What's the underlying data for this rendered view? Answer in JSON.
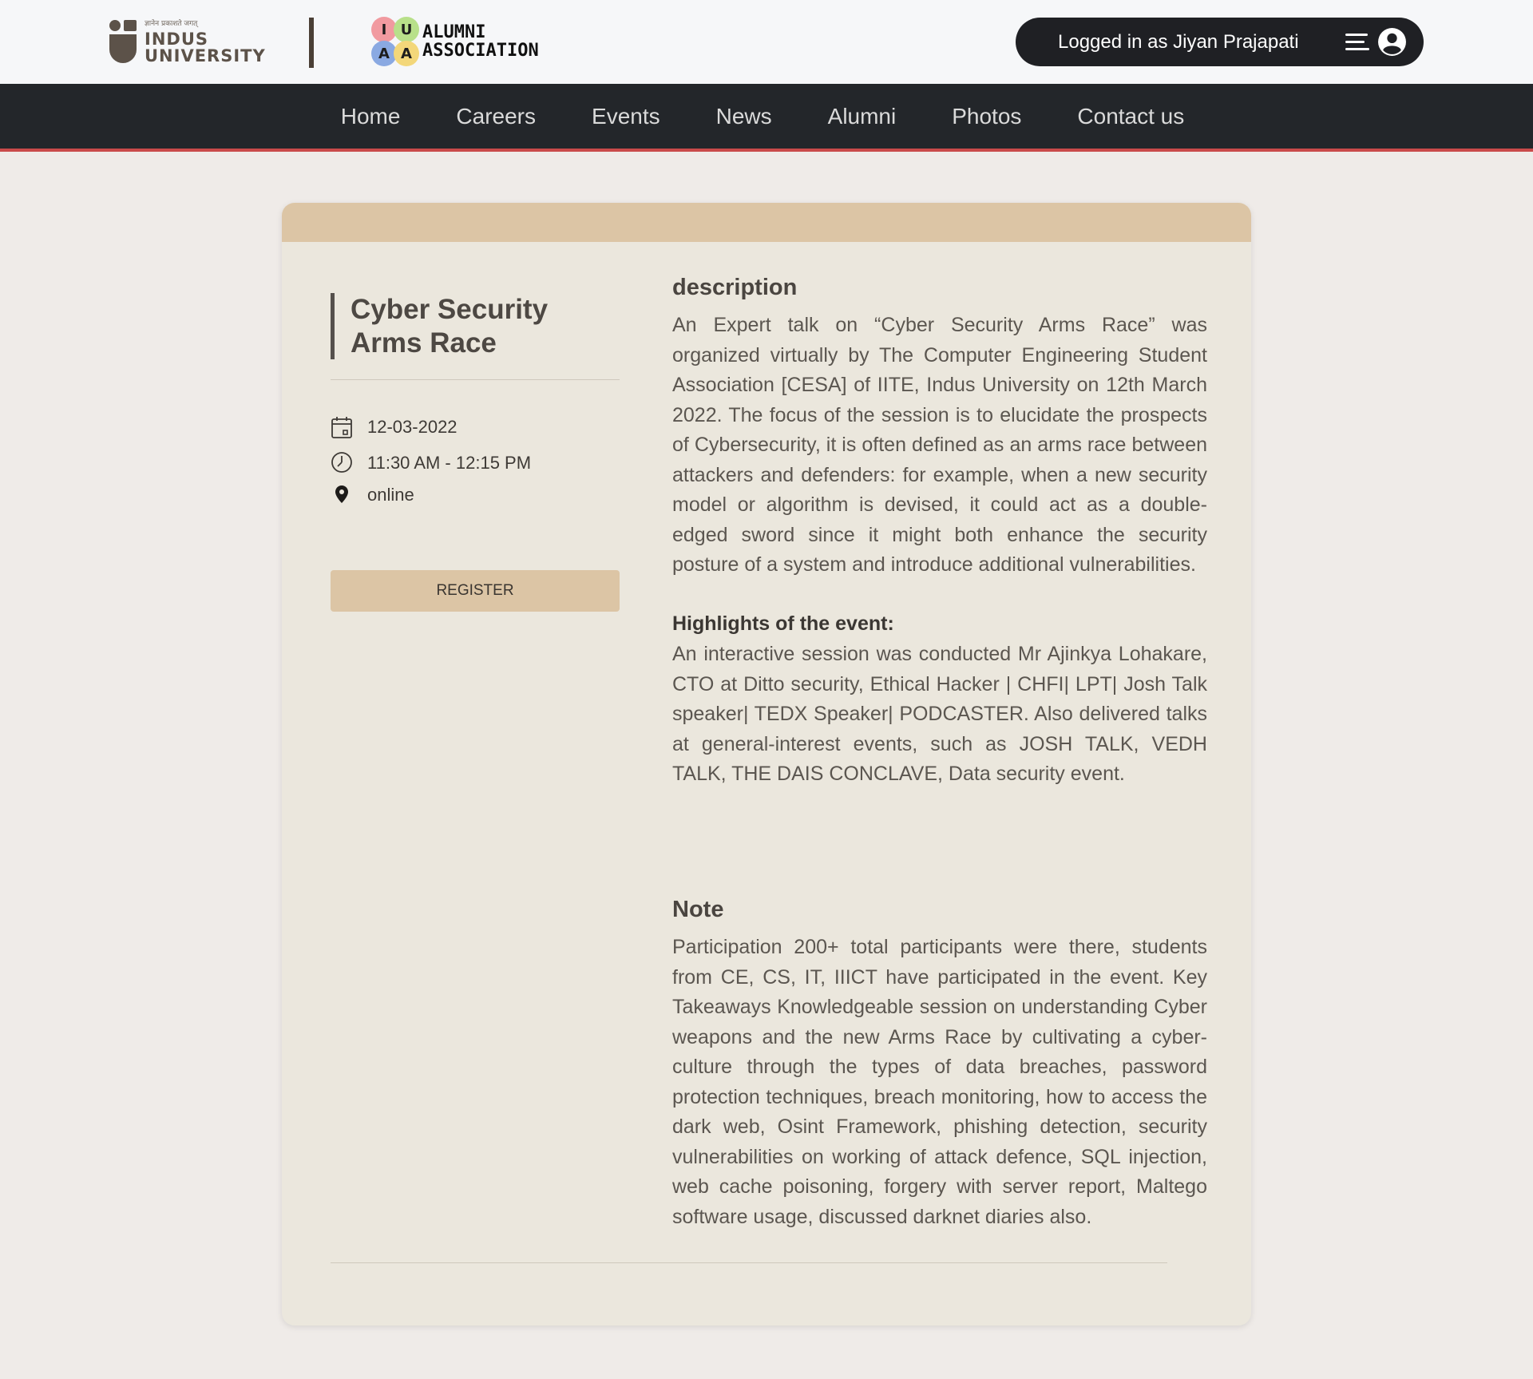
{
  "header": {
    "indus_logo": {
      "tagline": "ज्ञानेन प्रकाशते जगत्",
      "line1": "INDUS",
      "line2": "UNIVERSITY"
    },
    "alumni_logo": {
      "letters": [
        "I",
        "U",
        "A",
        "A"
      ],
      "line1": "ALUMNI",
      "line2": "ASSOCIATION"
    },
    "user_status": "Logged in as Jiyan Prajapati",
    "menu_icon": "hamburger-icon",
    "avatar_icon": "user-circle-icon"
  },
  "nav": {
    "items": [
      "Home",
      "Careers",
      "Events",
      "News",
      "Alumni",
      "Photos",
      "Contact us"
    ]
  },
  "colors": {
    "nav_bg": "#23262a",
    "nav_accent": "#c94a4a",
    "card_bg": "#ebe7dd",
    "card_header": "#dcc5a5",
    "page_bg": "#efebe8"
  },
  "event": {
    "title": "Cyber Security Arms Race",
    "date": "12-03-2022",
    "time": "11:30 AM - 12:15 PM",
    "location": "online",
    "register_label": "REGISTER",
    "icons": {
      "date": "calendar-icon",
      "time": "clock-icon",
      "location": "map-pin-icon"
    }
  },
  "description": {
    "heading": "description",
    "text": "An Expert talk on “Cyber Security Arms Race” was organized virtually by The Computer Engineering Student Association [CESA] of IITE, Indus University on 12th March 2022. The focus of the session is to elucidate the prospects of Cybersecurity, it is often defined as an arms race between attackers and defenders: for example, when a new security model or algorithm is devised, it could act as a double-edged sword since it might both enhance the security posture of a system and introduce additional vulnerabilities."
  },
  "highlights": {
    "heading": "Highlights of the event:",
    "text": "An interactive session was conducted Mr Ajinkya Lohakare, CTO at Ditto security, Ethical Hacker | CHFI| LPT| Josh Talk speaker| TEDX Speaker| PODCASTER. Also delivered talks at general-interest events, such as JOSH TALK, VEDH TALK, THE DAIS CONCLAVE, Data security event."
  },
  "note": {
    "heading": "Note",
    "text": "Participation 200+ total participants were there, students from CE, CS, IT, IIICT have participated in the event. Key Takeaways Knowledgeable session on understanding Cyber weapons and the new Arms Race by cultivating a cyber-culture through the types of data breaches, password protection techniques, breach monitoring, how to access the dark web, Osint Framework, phishing detection, security vulnerabilities on working of attack defence, SQL injection, web cache poisoning, forgery with server report, Maltego software usage, discussed darknet diaries also."
  }
}
